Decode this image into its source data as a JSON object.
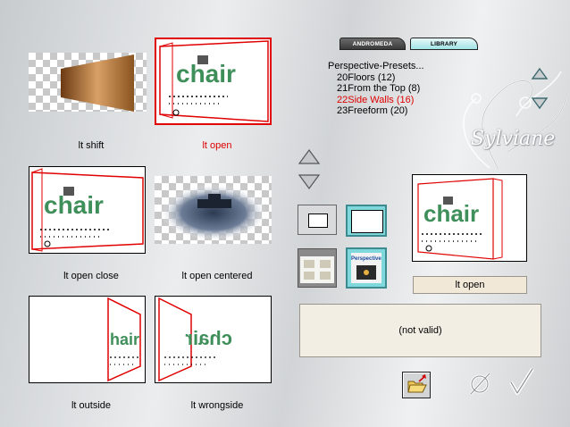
{
  "tabs": [
    "ANDROMEDA",
    "LIBRARY"
  ],
  "presets": {
    "root": "Perspective-Presets...",
    "items": [
      "20Floors (12)",
      "21From the Top (8)",
      "22Side Walls (16)",
      "23Freeform (20)"
    ],
    "selected_index": 2
  },
  "thumbnails": [
    {
      "caption": "lt shift",
      "selected": false
    },
    {
      "caption": "lt open",
      "selected": true
    },
    {
      "caption": "lt open close",
      "selected": false
    },
    {
      "caption": "lt open centered",
      "selected": false
    },
    {
      "caption": "lt outside",
      "selected": false
    },
    {
      "caption": "lt wrongside",
      "selected": false
    }
  ],
  "chair_word": "chair",
  "preview_label": "lt open",
  "status_text": "(not valid)",
  "watermark": "Sylviane",
  "persp_button_text": "Perspective",
  "icons": {
    "scroll_up": "triangle-up-icon",
    "scroll_down": "triangle-down-icon",
    "cancel": "cancel-icon",
    "ok": "checkmark-icon",
    "open_folder": "open-folder-icon"
  },
  "colors": {
    "selected": "#e00000",
    "tab_active": "#9fe3e6",
    "status_bg": "#f3eee4"
  }
}
